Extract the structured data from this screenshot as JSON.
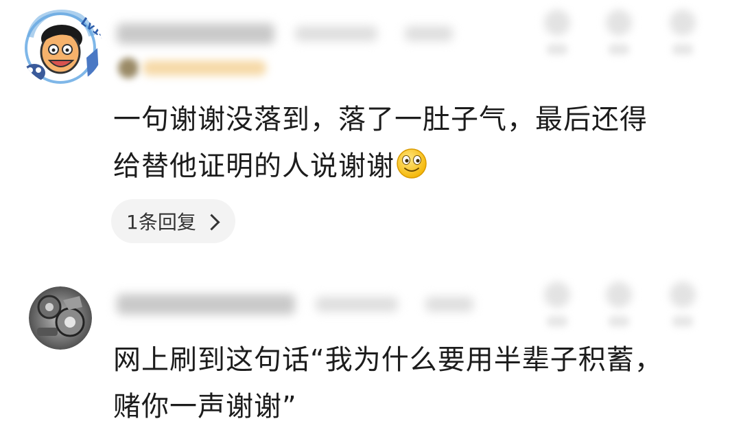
{
  "comments": [
    {
      "avatar_badge": "Lv14",
      "avatar_icon": "cartoon-avatar-icon",
      "text_line1": "一句谢谢没落到，落了一肚子气，最后还得",
      "text_line2": "给替他证明的人说谢谢",
      "emoji_icon": "smile-emoji-icon",
      "reply_label": "1条回复"
    },
    {
      "avatar_icon": "mechanical-gear-avatar-icon",
      "text_line1": "网上刷到这句话“我为什么要用半辈子积蓄，",
      "text_line2": "赌你一声谢谢”"
    }
  ],
  "colors": {
    "text": "#1c1c1c",
    "pill_bg": "#f3f3f3",
    "badge_accent": "#f6d9a7"
  }
}
